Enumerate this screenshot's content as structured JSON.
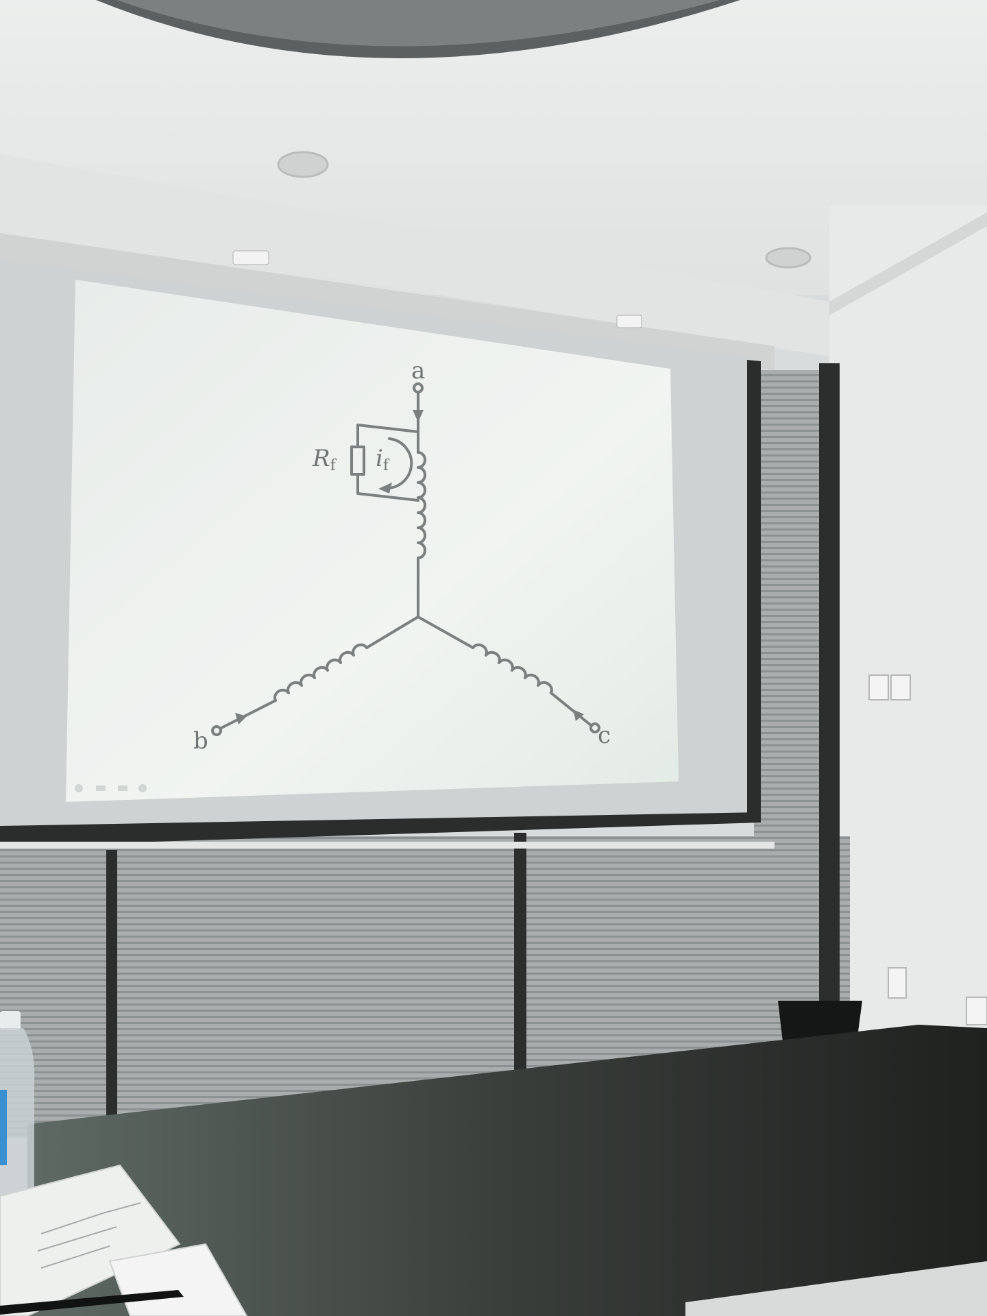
{
  "diagram": {
    "terminal_a": "a",
    "terminal_b": "b",
    "terminal_c": "c",
    "resistor_label": {
      "main": "R",
      "sub": "f"
    },
    "current_label": {
      "main": "i",
      "sub": "f"
    }
  },
  "colors": {
    "wire": "#7a7f80",
    "screen": "#eef1ee",
    "wall": "#e6e8e6",
    "table": "#2f3230"
  }
}
